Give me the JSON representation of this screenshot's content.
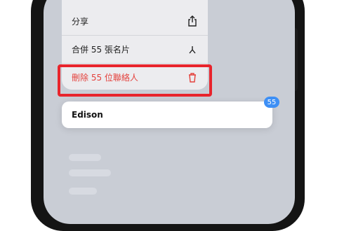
{
  "menu": {
    "items": [
      {
        "label": "分享",
        "icon": "share-icon"
      },
      {
        "label": "合併 55 張名片",
        "icon": "merge-icon"
      },
      {
        "label": "刪除 55 位聯絡人",
        "icon": "trash-icon",
        "color": "#e4403b"
      }
    ]
  },
  "contact": {
    "name": "Edison"
  },
  "selection": {
    "count": "55"
  },
  "colors": {
    "highlight": "#e8242c",
    "badge": "#3d8ff5",
    "danger": "#e4403b"
  }
}
